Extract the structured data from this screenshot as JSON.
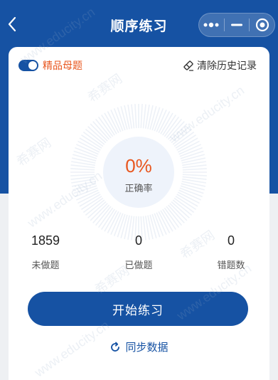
{
  "navbar": {
    "title": "顺序练习",
    "back_icon": "chevron-left-icon",
    "more_icon": "more-dots-icon",
    "minimize_icon": "minimize-icon",
    "close_icon": "target-circle-icon"
  },
  "toggle": {
    "label": "精品母题",
    "on": true
  },
  "clear_history": {
    "label": "清除历史记录",
    "icon": "eraser-icon"
  },
  "accuracy": {
    "value": "0%",
    "label": "正确率",
    "progress": 0
  },
  "stats": [
    {
      "value": "1859",
      "label": "未做题"
    },
    {
      "value": "0",
      "label": "已做题"
    },
    {
      "value": "0",
      "label": "错题数"
    }
  ],
  "start_button": {
    "label": "开始练习"
  },
  "sync": {
    "label": "同步数据",
    "icon": "refresh-icon"
  },
  "watermark": {
    "site": "www.educity.cn",
    "brand": "希赛网"
  },
  "colors": {
    "primary": "#1652a3",
    "accent": "#e8561e",
    "background": "#eef0f3"
  }
}
